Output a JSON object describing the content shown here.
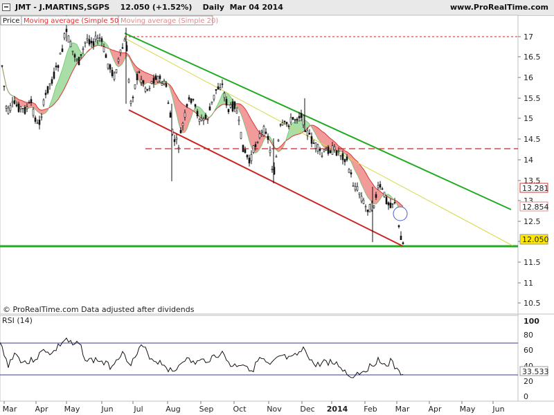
{
  "header": {
    "title": "JMT - J.MARTINS,SGPS    12.050 (+1.52%)    Daily  Mar 04 2014",
    "site": "www.ProRealTime.com"
  },
  "price_panel": {
    "legend": {
      "price": "Price",
      "ma50": "Moving average (Simple 50)",
      "ma20": "Moving average (Simple 20)"
    },
    "copyright": "© ProRealTime.com  Data adjusted after dividends",
    "y_ticks": [
      "17",
      "16.5",
      "16",
      "15.5",
      "15",
      "14.5",
      "14",
      "13.5",
      "13",
      "12.5",
      "12",
      "11.5",
      "11",
      "10.5"
    ],
    "value_badges": {
      "ma50": "13.281",
      "ma20": "12.854",
      "price": "12.050"
    }
  },
  "rsi_panel": {
    "label": "RSI (14)",
    "y_ticks": [
      "100",
      "80",
      "60",
      "40",
      "20",
      "0"
    ],
    "value_badge": "33.533"
  },
  "x_axis": [
    "Mar",
    "Apr",
    "May",
    "Jun",
    "Jul",
    "Aug",
    "Sep",
    "Oct",
    "Nov",
    "Dec",
    "2014",
    "Feb",
    "Mar",
    "Apr",
    "May",
    "Jun"
  ],
  "colors": {
    "ma50": "#e03030",
    "ma20": "#9ad89a",
    "up_channel": "#22aa22",
    "down_channel": "#cc2222",
    "support": "#22aa22",
    "candles": "#111111"
  },
  "chart_data": {
    "type": "candlestick",
    "price_ylim": [
      10.3,
      17.4
    ],
    "key_values": {
      "last_price": 12.05,
      "change_pct": 1.52,
      "ma50": 13.281,
      "ma20": 12.854,
      "rsi": 33.533
    },
    "horizontal_levels": [
      17.0,
      14.25,
      11.9
    ],
    "rsi_ylim": [
      0,
      100
    ],
    "rsi_levels": [
      70,
      30
    ]
  }
}
